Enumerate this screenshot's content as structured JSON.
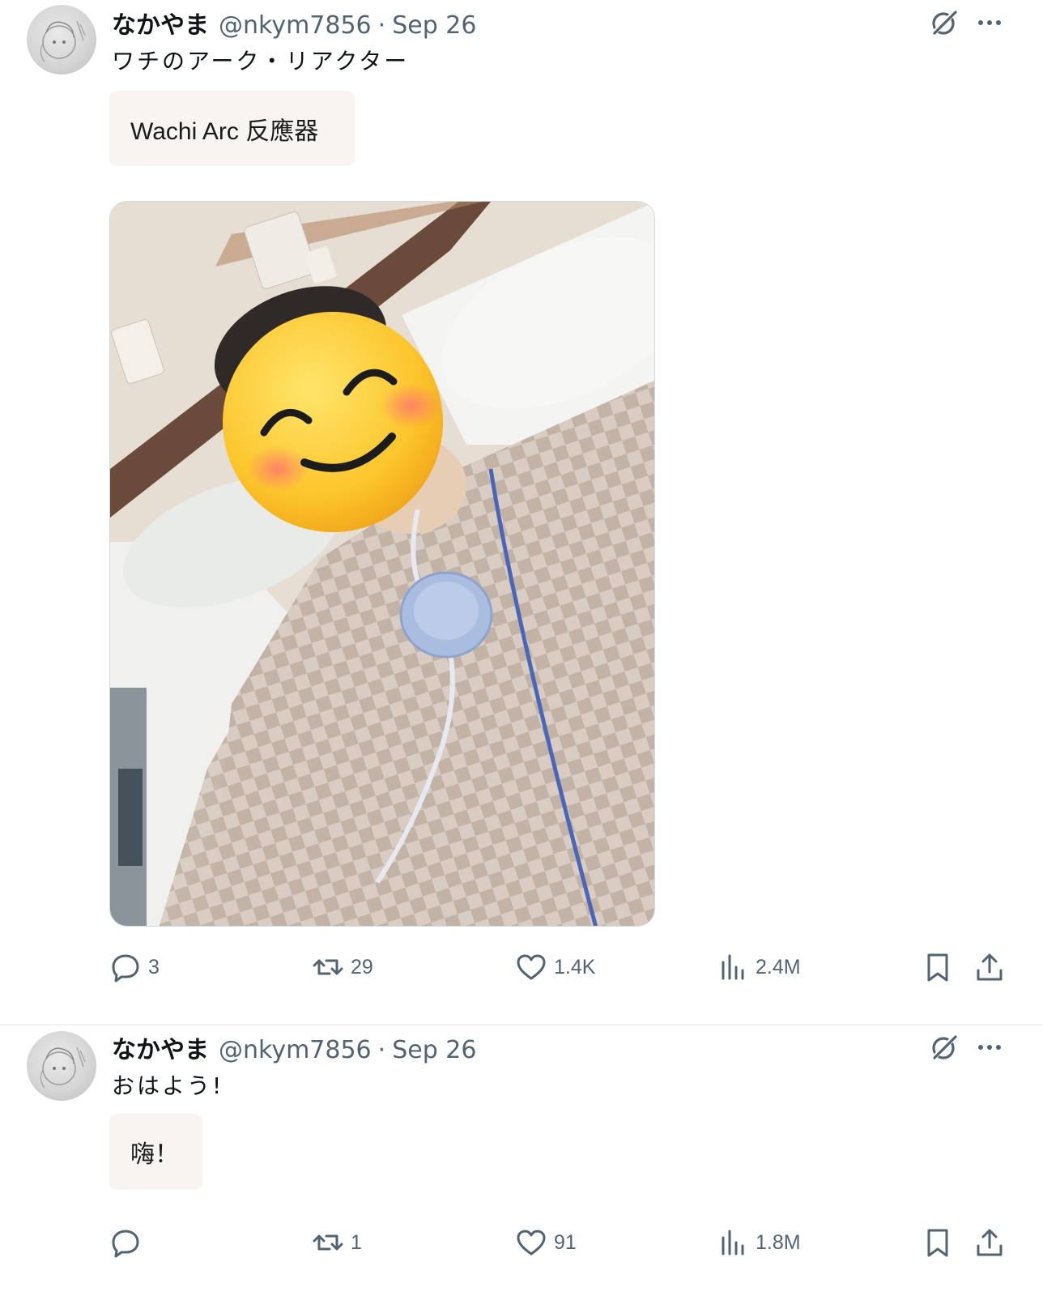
{
  "colors": {
    "text_primary": "#0f1419",
    "text_secondary": "#536471",
    "translation_bg": "#f8f4f2",
    "divider": "#eff3f4"
  },
  "tweets": [
    {
      "display_name": "なかやま",
      "handle": "@nkym7856",
      "separator": "·",
      "date": "Sep 26",
      "text": "ワチのアーク・リアクター",
      "translation": "Wachi Arc 反應器",
      "has_media": true,
      "stats": {
        "replies": "3",
        "retweets": "29",
        "likes": "1.4K",
        "views": "2.4M"
      }
    },
    {
      "display_name": "なかやま",
      "handle": "@nkym7856",
      "separator": "·",
      "date": "Sep 26",
      "text": "おはよう!",
      "translation": "嗨！",
      "has_media": false,
      "stats": {
        "replies": "",
        "retweets": "1",
        "likes": "91",
        "views": "1.8M"
      }
    }
  ],
  "icons": {
    "header": [
      "grok-icon",
      "more-icon"
    ],
    "actions": [
      "reply-icon",
      "retweet-icon",
      "like-icon",
      "views-icon",
      "bookmark-icon",
      "share-icon"
    ]
  }
}
